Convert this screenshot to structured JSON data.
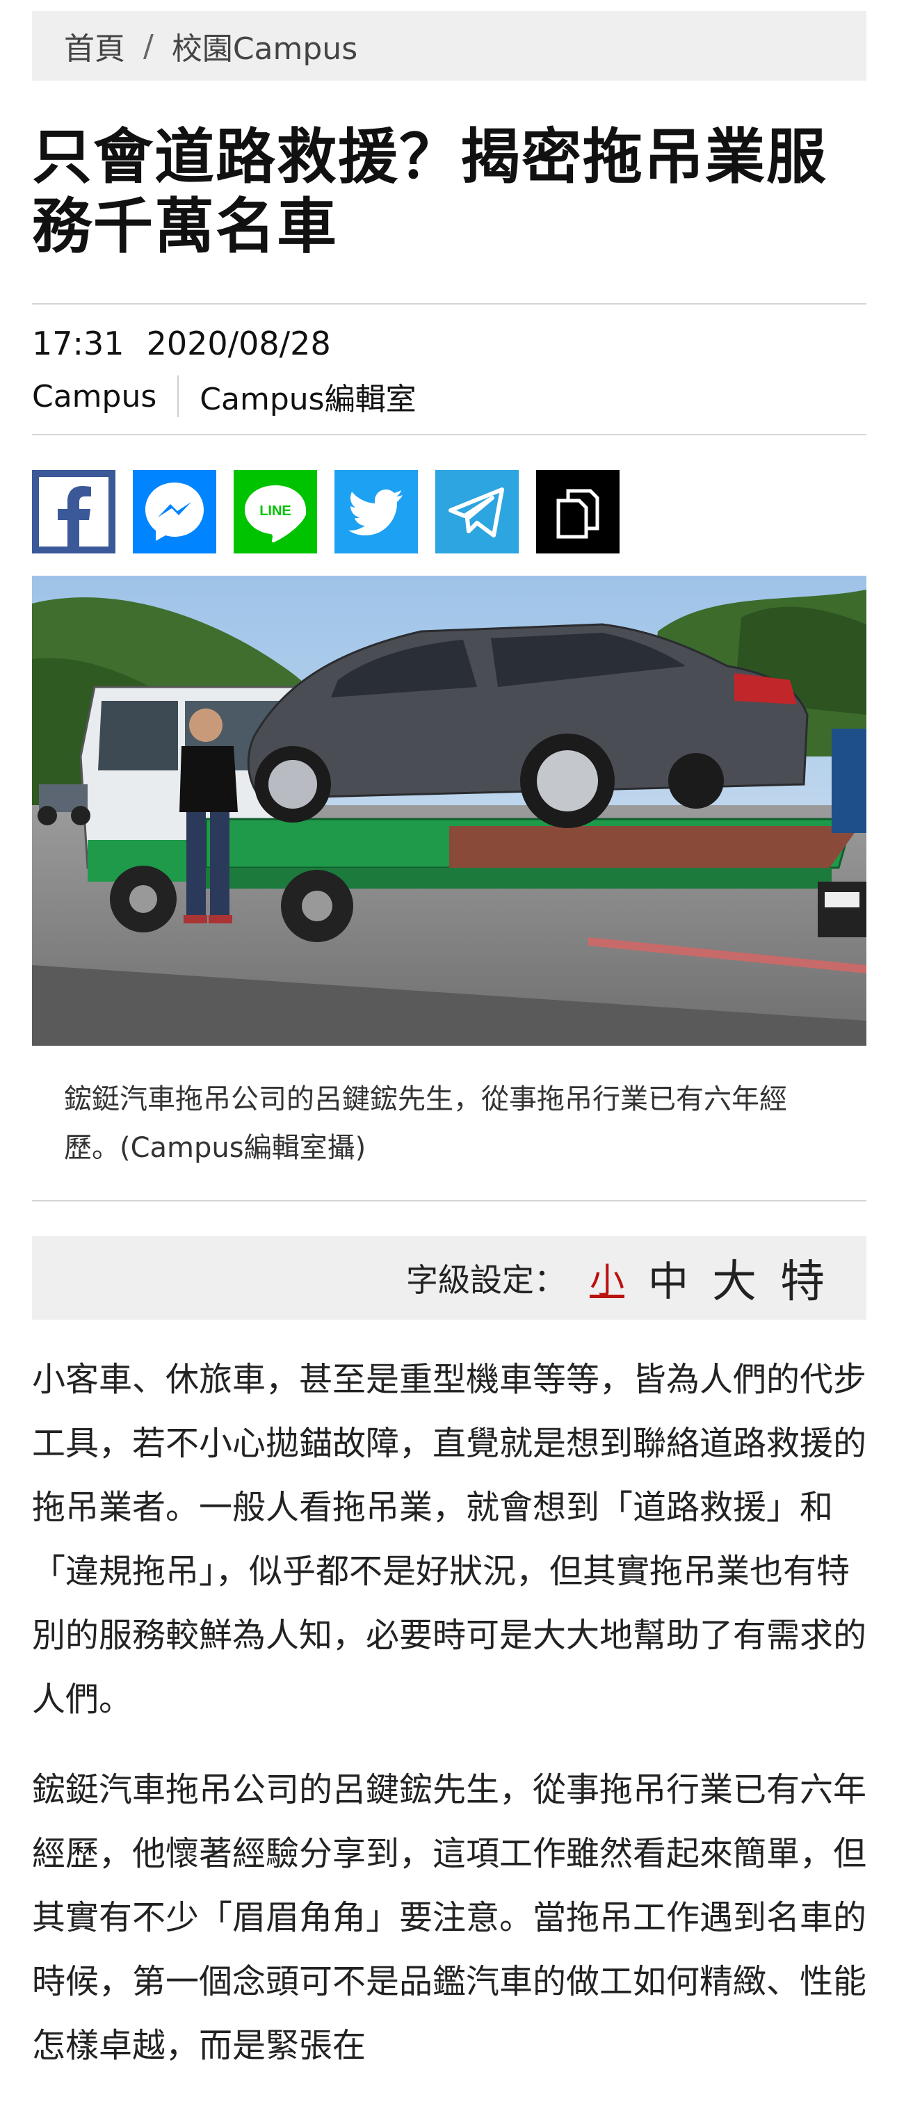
{
  "breadcrumb": {
    "home": "首頁",
    "separator": "/",
    "section": "校園Campus"
  },
  "article": {
    "title": "只會道路救援？揭密拖吊業服務千萬名車",
    "time": "17:31",
    "date": "2020/08/28",
    "category": "Campus",
    "author": "Campus編輯室"
  },
  "share": {
    "icons": [
      "facebook-icon",
      "messenger-icon",
      "line-icon",
      "twitter-icon",
      "telegram-icon",
      "copy-link-icon"
    ],
    "line_label": "LINE",
    "colors": {
      "facebook": "#3b5998",
      "messenger": "#0084ff",
      "line": "#00c300",
      "twitter": "#1da1f2",
      "telegram": "#2ca5e0",
      "copy": "#000000"
    }
  },
  "photo": {
    "caption": "鋐鋌汽車拖吊公司的呂鍵鋐先生，從事拖吊行業已有六年經歷。(Campus編輯室攝)"
  },
  "font_size": {
    "label": "字級設定：",
    "options": [
      "小",
      "中",
      "大",
      "特"
    ],
    "selected": "小"
  },
  "paragraphs": [
    "小客車、休旅車，甚至是重型機車等等，皆為人們的代步工具，若不小心拋錨故障，直覺就是想到聯絡道路救援的拖吊業者。一般人看拖吊業，就會想到「道路救援」和「違規拖吊」，似乎都不是好狀況，但其實拖吊業也有特別的服務較鮮為人知，必要時可是大大地幫助了有需求的人們。",
    "鋐鋌汽車拖吊公司的呂鍵鋐先生，從事拖吊行業已有六年經歷，他懷著經驗分享到，這項工作雖然看起來簡單，但其實有不少「眉眉角角」要注意。當拖吊工作遇到名車的時候，第一個念頭可不是品鑑汽車的做工如何精緻、性能怎樣卓越，而是緊張在"
  ]
}
